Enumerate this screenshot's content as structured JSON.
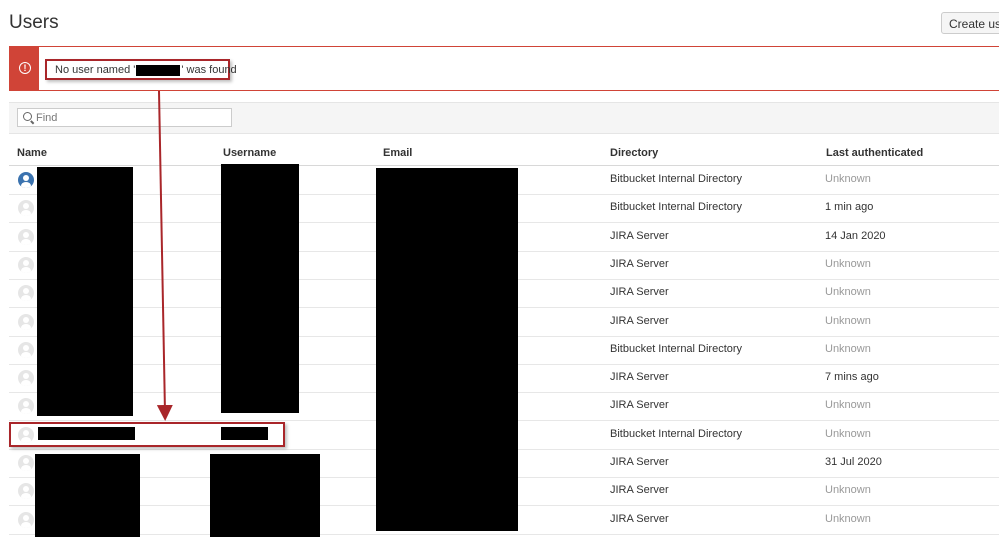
{
  "page": {
    "title": "Users",
    "create_button_label": "Create user"
  },
  "banner": {
    "icon": "error-icon",
    "message_prefix": "No user named '",
    "message_suffix": "' was found",
    "accent_color": "#d04437"
  },
  "search": {
    "placeholder": "Find",
    "value": ""
  },
  "table": {
    "headers": {
      "name": "Name",
      "username": "Username",
      "email": "Email",
      "directory": "Directory",
      "last_authenticated": "Last authenticated"
    },
    "rows": [
      {
        "avatar": "blue",
        "directory": "Bitbucket Internal Directory",
        "last_authenticated": "Unknown"
      },
      {
        "avatar": "grey",
        "directory": "Bitbucket Internal Directory",
        "last_authenticated": "1 min ago"
      },
      {
        "avatar": "grey",
        "directory": "JIRA Server",
        "last_authenticated": "14 Jan 2020"
      },
      {
        "avatar": "grey",
        "directory": "JIRA Server",
        "last_authenticated": "Unknown"
      },
      {
        "avatar": "grey",
        "directory": "JIRA Server",
        "last_authenticated": "Unknown"
      },
      {
        "avatar": "grey",
        "directory": "JIRA Server",
        "last_authenticated": "Unknown"
      },
      {
        "avatar": "grey",
        "directory": "Bitbucket Internal Directory",
        "last_authenticated": "Unknown"
      },
      {
        "avatar": "grey",
        "directory": "JIRA Server",
        "last_authenticated": "7 mins ago"
      },
      {
        "avatar": "grey",
        "directory": "JIRA Server",
        "last_authenticated": "Unknown"
      },
      {
        "avatar": "grey",
        "directory": "Bitbucket Internal Directory",
        "last_authenticated": "Unknown"
      },
      {
        "avatar": "grey",
        "directory": "JIRA Server",
        "last_authenticated": "31 Jul 2020"
      },
      {
        "avatar": "grey",
        "directory": "JIRA Server",
        "last_authenticated": "Unknown"
      },
      {
        "avatar": "grey",
        "directory": "JIRA Server",
        "last_authenticated": "Unknown"
      }
    ]
  },
  "annotation": {
    "highlight_color": "#a9262a",
    "arrow_color": "#a9262a"
  }
}
